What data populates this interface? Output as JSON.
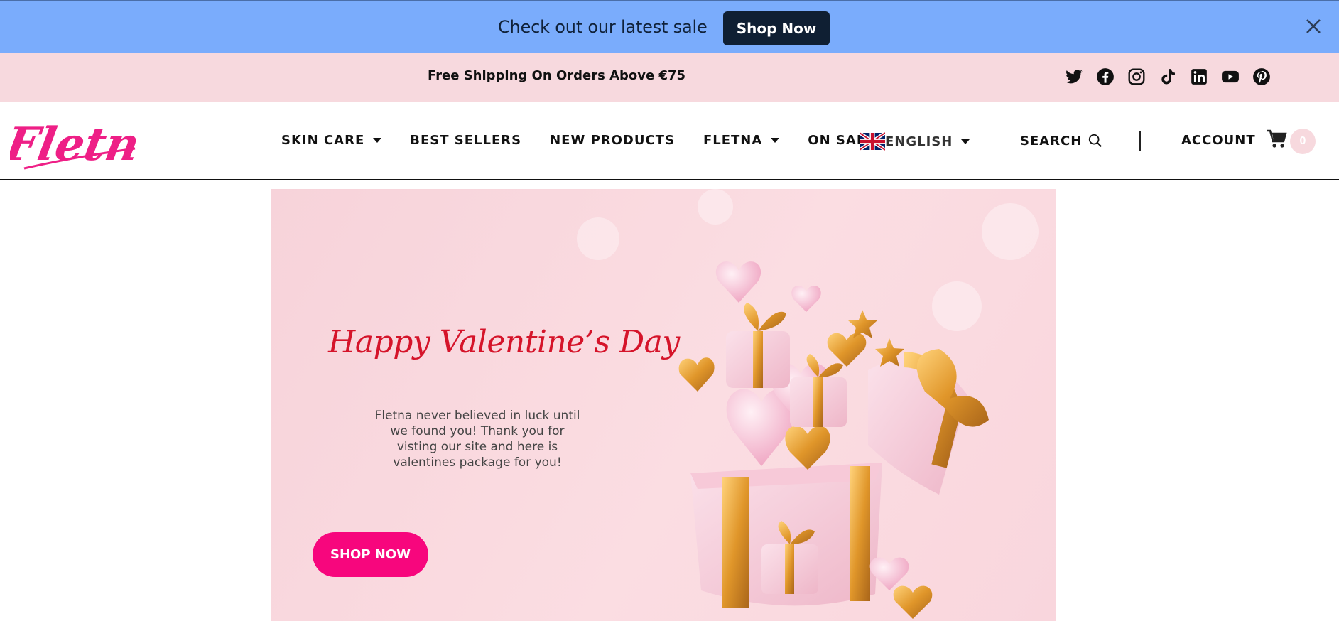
{
  "announcement": {
    "text": "Check out our latest sale",
    "button_label": "Shop Now"
  },
  "shipping": {
    "text": "Free Shipping On Orders Above €75"
  },
  "socials": [
    "twitter-icon",
    "facebook-icon",
    "instagram-icon",
    "tiktok-icon",
    "linkedin-icon",
    "youtube-icon",
    "pinterest-icon"
  ],
  "header": {
    "nav": [
      {
        "label": "SKIN CARE",
        "dropdown": true
      },
      {
        "label": "BEST SELLERS",
        "dropdown": false
      },
      {
        "label": "NEW PRODUCTS",
        "dropdown": false
      },
      {
        "label": "FLETNA",
        "dropdown": true
      },
      {
        "label": "ON SALE",
        "dropdown": false
      }
    ],
    "language": "ENGLISH",
    "search_label": "SEARCH",
    "account_label": "ACCOUNT",
    "cart_count": "0"
  },
  "hero": {
    "title": "Happy Valentine’s Day",
    "text": "Fletna never believed in luck until we found you! Thank you for visting our site and here is valentines package for you!",
    "button_label": "SHOP NOW"
  },
  "colors": {
    "announce_bg": "#7aacfc",
    "ship_bg": "#f7d9de",
    "brand_pink": "#f7067d",
    "hero_title": "#d5142a",
    "dark_button": "#0f1f33"
  }
}
